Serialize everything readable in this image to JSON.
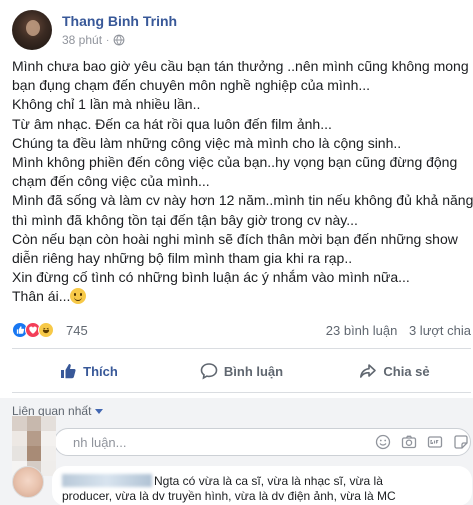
{
  "post": {
    "author": "Thang Binh Trinh",
    "time": "38 phút",
    "separator": "·",
    "lines": [
      "Mình chưa bao giờ yêu cầu bạn tán thưởng ..nên mình cũng không mong",
      "bạn đụng chạm đến chuyên môn nghề nghiệp của mình...",
      "Không chỉ 1 lần mà nhiều lần..",
      "Từ âm nhạc. Đến ca hát rồi qua luôn đến film ảnh...",
      "Chúng ta đều làm những công việc mà mình cho là cộng sinh..",
      "Mình không phiền đến công việc của bạn..hy vọng bạn cũng đừng động",
      "chạm đến công việc của mình...",
      "Mình đã sống và làm cv này hơn 12 năm..mình tin nếu không đủ khả năng",
      "thì mình đã không tồn tại đến tận bây giờ trong cv này...",
      "Còn nếu bạn còn hoài nghi mình sẽ đích thân mời bạn đến những show",
      "diễn riêng hay những bộ film mình tham gia khi ra rạp..",
      "Xin đừng cố tình có những bình luận ác ý nhắm vào mình nữa...",
      "Thân ái..."
    ],
    "closing_emoji": "smile-emoji"
  },
  "reactions": {
    "count": "745",
    "comments": "23 bình luận",
    "shares": "3 lượt chia",
    "types": [
      "like",
      "love",
      "haha"
    ]
  },
  "actions": {
    "like": "Thích",
    "comment": "Bình luận",
    "share": "Chia sẻ"
  },
  "comments": {
    "sort_label": "Liên quan nhất",
    "composer_placeholder": "nh luận...",
    "composer_icons": [
      "smiley-icon",
      "camera-icon",
      "gif-icon",
      "sticker-icon"
    ],
    "items": [
      {
        "text_line1": "Ngta có vừa là ca sĩ, vừa là nhạc sĩ, vừa là",
        "text_line2": "producer, vừa là dv truyền hình, vừa là dv điện ảnh, vừa là MC"
      }
    ]
  },
  "colors": {
    "link_blue": "#385898",
    "like_blue": "#1877f2",
    "love_red": "#f33e58",
    "haha_yellow": "#f7c948",
    "muted_gray": "#606770",
    "divider": "#dadde1",
    "comment_bg": "#f2f3f5"
  }
}
